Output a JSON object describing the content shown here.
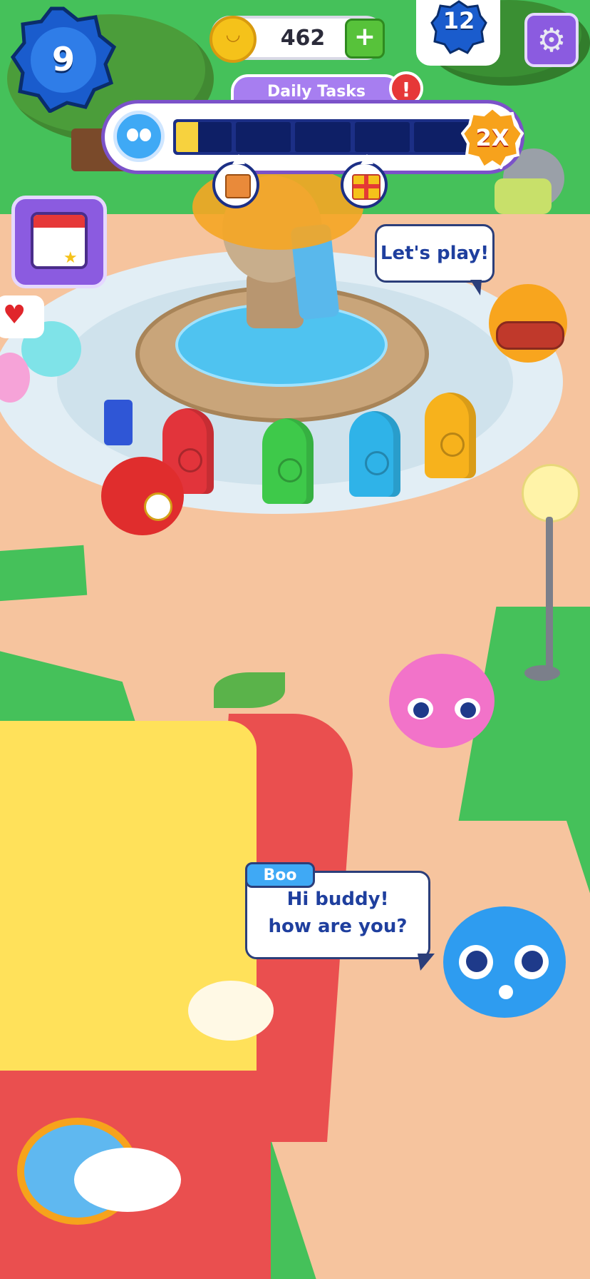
{
  "hud": {
    "level": "9",
    "coins": "462",
    "add_coins_symbol": "+",
    "box_count": "12",
    "settings_icon": "gear-icon"
  },
  "daily_tasks": {
    "title": "Daily Tasks",
    "alert_symbol": "!",
    "multiplier": "2X",
    "progress_segments": 5,
    "progress_fraction": 0.08,
    "rewards": [
      "box-icon",
      "gift-icon"
    ]
  },
  "side_buttons": {
    "calendar_icon": "calendar-icon",
    "heart_icon": "heart-icon"
  },
  "dialogs": {
    "lets_play": "Let's play!",
    "speaker_name": "Boo",
    "greeting_line1": "Hi buddy!",
    "greeting_line2": "how are you?"
  },
  "colors": {
    "grass": "#45c15a",
    "path": "#f6c49e",
    "hud_purple": "#8b5be0",
    "bin_red": "#e2343b",
    "bin_green": "#3ec94a",
    "bin_blue": "#2fb3e8",
    "bin_yellow": "#f7b21c"
  }
}
